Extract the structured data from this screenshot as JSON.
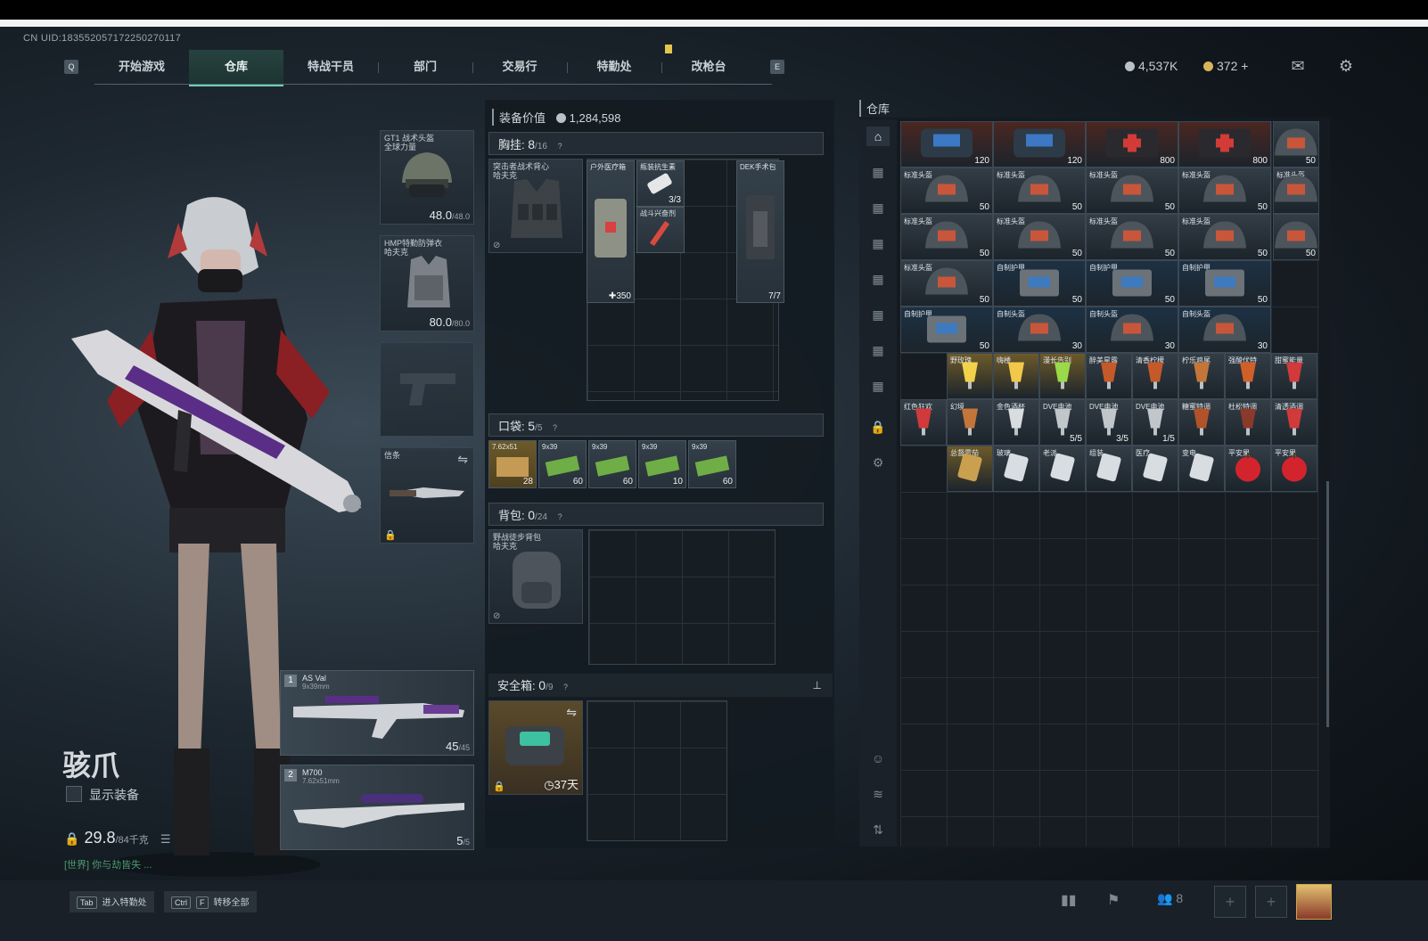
{
  "header": {
    "uid": "CN UID:18355205717225027011​7",
    "nav_key_left": "Q",
    "nav_key_right": "E",
    "tabs": [
      {
        "label": "开始游戏"
      },
      {
        "label": "仓库",
        "active": true
      },
      {
        "label": "特战干员"
      },
      {
        "label": "部门"
      },
      {
        "label": "交易行"
      },
      {
        "label": "特勤处"
      },
      {
        "label": "改枪台"
      }
    ],
    "currency_silver": "4,537K",
    "currency_gold": "372 +",
    "colors": {
      "accent": "#6fd0b2",
      "marker": "#e3c64a"
    }
  },
  "operator": {
    "name": "骇爪",
    "show_gear_label": "显示装备",
    "weight": "29.8",
    "weight_max": "/84千克",
    "chat_text": "[世界] 你与劫皆失 ...",
    "gear": {
      "helmet": {
        "label": "GT1 战术头盔\n全球力量",
        "value": "48.0",
        "max": "/48.0"
      },
      "armor": {
        "label": "HMP特勤防弹衣\n哈夫克",
        "value": "80.0",
        "max": "/80.0"
      },
      "melee": {
        "label": "信条"
      }
    },
    "weapons": [
      {
        "slot": "1",
        "name": "AS Val",
        "caliber": "9x39mm",
        "ammo": "45",
        "ammo_max": "/45"
      },
      {
        "slot": "2",
        "name": "M700",
        "caliber": "7.62x51mm",
        "ammo": "5",
        "ammo_max": "/5"
      }
    ]
  },
  "loadout": {
    "equip_value_label": "装备价值",
    "equip_value": "1,284,598",
    "chest": {
      "title": "胸挂:",
      "count": "8",
      "max": "/16",
      "rig_name": "突击者战术背心\n哈夫克",
      "items": [
        {
          "label": "户外医疗箱",
          "count": "350"
        },
        {
          "label": "瓶装抗生素",
          "count": "3/3"
        },
        {
          "label": "战斗兴奋剂"
        },
        {
          "label": "DEK手术包",
          "count": "7/7"
        }
      ]
    },
    "pocket": {
      "title": "口袋:",
      "count": "5",
      "max": "/5",
      "items": [
        {
          "label": "7.62x51",
          "count": "28"
        },
        {
          "label": "9x39",
          "count": "60"
        },
        {
          "label": "9x39",
          "count": "60"
        },
        {
          "label": "9x39",
          "count": "10"
        },
        {
          "label": "9x39",
          "count": "60"
        }
      ]
    },
    "backpack": {
      "title": "背包:",
      "count": "0",
      "max": "/24",
      "name": "野战徒步背包\n哈夫克"
    },
    "safebox": {
      "title": "安全箱:",
      "count": "0",
      "max": "/9",
      "days": "37天"
    }
  },
  "warehouse": {
    "title": "仓库",
    "rows": [
      [
        {
          "c": "120",
          "t": "bag"
        },
        {
          "c": "120",
          "t": "bag"
        },
        {
          "c": "800",
          "t": "med"
        },
        {
          "c": "800",
          "t": "med"
        },
        {
          "c": "50",
          "t": "helm"
        }
      ],
      [
        {
          "l": "标准头盔",
          "c": "50",
          "t": "helm"
        },
        {
          "l": "标准头盔",
          "c": "50",
          "t": "helm"
        },
        {
          "l": "标准头盔",
          "c": "50",
          "t": "helm"
        },
        {
          "l": "标准头盔",
          "c": "50",
          "t": "helm"
        },
        {
          "l": "标准头盔",
          "c": "",
          "t": "helm"
        }
      ],
      [
        {
          "l": "标准头盔",
          "c": "50",
          "t": "helm"
        },
        {
          "l": "标准头盔",
          "c": "50",
          "t": "helm"
        },
        {
          "l": "标准头盔",
          "c": "50",
          "t": "helm"
        },
        {
          "l": "标准头盔",
          "c": "50",
          "t": "helm"
        },
        {
          "l": "",
          "c": "50",
          "t": "helm"
        }
      ],
      [
        {
          "l": "标准头盔",
          "c": "50",
          "t": "helm"
        },
        {
          "l": "自制护甲",
          "c": "50",
          "t": "vest"
        },
        {
          "l": "自制护甲",
          "c": "50",
          "t": "vest"
        },
        {
          "l": "自制护甲",
          "c": "50",
          "t": "vest"
        }
      ],
      [
        {
          "l": "自制护甲",
          "c": "50",
          "t": "vest"
        },
        {
          "l": "自制头盔",
          "c": "30",
          "t": "helm"
        },
        {
          "l": "自制头盔",
          "c": "30",
          "t": "helm"
        },
        {
          "l": "自制头盔",
          "c": "30",
          "t": "helm"
        }
      ]
    ],
    "drink_row1": [
      "野玫瑰",
      "嗨楼",
      "漫长告别",
      "醉美星露",
      "清香柠檬",
      "柠乐鸡尾",
      "强酸伏特",
      "甜蜜能量"
    ],
    "drink_row2": [
      {
        "l": "红色狂欢"
      },
      {
        "l": "幻境"
      },
      {
        "l": "金色酒杯"
      },
      {
        "l": "DVE电池",
        "c": "5/5"
      },
      {
        "l": "DVE电池",
        "c": "3/5"
      },
      {
        "l": "DVE电池",
        "c": "1/5"
      },
      {
        "l": "糖蜜特调"
      },
      {
        "l": "杜松特调"
      },
      {
        "l": "清透酒调"
      }
    ],
    "misc_row": [
      "总督雪茄",
      "玻璃",
      "老派",
      "组装",
      "医疗",
      "变电",
      "平安果",
      "平安果"
    ],
    "colors": {
      "gold_bg": "#6d5a2a",
      "blue_bg": "#1d3144",
      "red_bg": "#4a2622",
      "grey_bg": "#333d46"
    }
  },
  "bottom": {
    "hint1_key": "Tab",
    "hint1": "进入特勤处",
    "hint2_key1": "Ctrl",
    "hint2_key2": "F",
    "hint2": "转移全部",
    "squad_count": "8"
  }
}
